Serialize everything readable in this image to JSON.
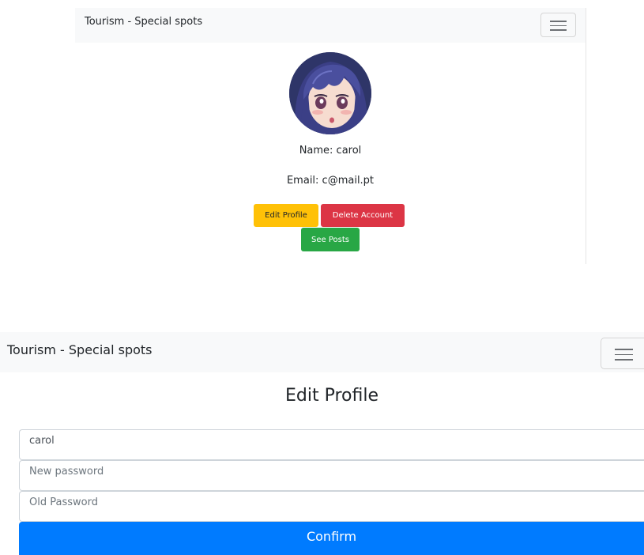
{
  "profile_view": {
    "navbar": {
      "brand": "Tourism - Special spots",
      "toggler_icon": "hamburger-menu-icon"
    },
    "avatar_description": "anime-character-avatar",
    "name_line": "Name: carol",
    "email_line": "Email: c@mail.pt",
    "buttons": {
      "edit_profile": "Edit Profile",
      "delete_account": "Delete Account",
      "see_posts": "See Posts"
    },
    "colors": {
      "edit": "#ffc107",
      "delete": "#dc3545",
      "posts": "#28a745"
    }
  },
  "edit_profile_view": {
    "navbar": {
      "brand": "Tourism - Special spots",
      "toggler_icon": "hamburger-menu-icon"
    },
    "title": "Edit Profile",
    "fields": {
      "username_value": "carol",
      "new_password_placeholder": "New password",
      "old_password_placeholder": "Old Password"
    },
    "confirm_label": "Confirm",
    "colors": {
      "confirm": "#007bff",
      "navbar_bg": "#f8f9fa"
    }
  }
}
